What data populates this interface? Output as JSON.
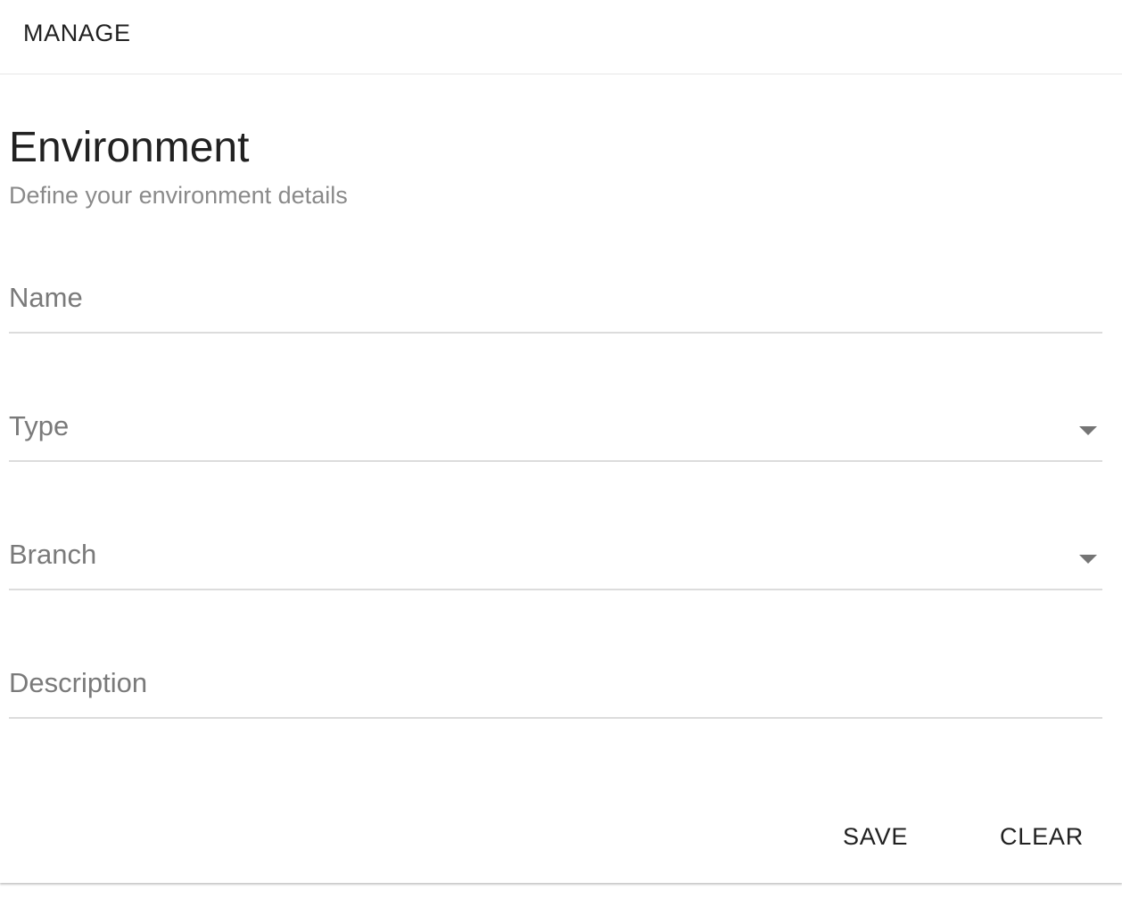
{
  "header": {
    "tab_manage": "MANAGE"
  },
  "form": {
    "title": "Environment",
    "subtitle": "Define your environment details",
    "fields": {
      "name": {
        "label": "Name",
        "value": ""
      },
      "type": {
        "label": "Type",
        "value": ""
      },
      "branch": {
        "label": "Branch",
        "value": ""
      },
      "description": {
        "label": "Description",
        "value": ""
      }
    },
    "actions": {
      "save": "SAVE",
      "clear": "CLEAR"
    }
  },
  "icons": {
    "type_dropdown": "chevron-down-icon",
    "branch_dropdown": "chevron-down-icon"
  }
}
